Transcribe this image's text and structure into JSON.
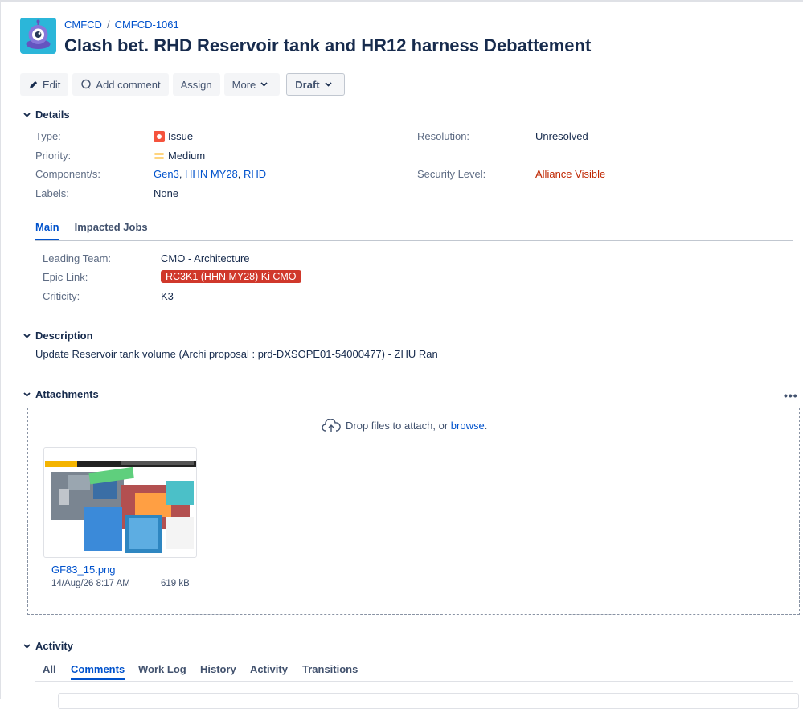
{
  "breadcrumb": {
    "project": "CMFCD",
    "separator": "/",
    "issue_key": "CMFCD-1061"
  },
  "title": "Clash bet. RHD Reservoir tank and HR12 harness Debattement",
  "toolbar": {
    "edit_label": "Edit",
    "comment_label": "Add comment",
    "assign_label": "Assign",
    "more_label": "More",
    "status_label": "Draft"
  },
  "details": {
    "heading": "Details",
    "type_label": "Type:",
    "type_value": "Issue",
    "priority_label": "Priority:",
    "priority_value": "Medium",
    "components_label": "Component/s:",
    "components": [
      "Gen3",
      "HHN MY28",
      "RHD"
    ],
    "component_separator": ", ",
    "labels_label": "Labels:",
    "labels_value": "None",
    "resolution_label": "Resolution:",
    "resolution_value": "Unresolved",
    "security_label": "Security Level:",
    "security_value": "Alliance Visible"
  },
  "tabs": [
    "Main",
    "Impacted Jobs"
  ],
  "main": {
    "leading_team_label": "Leading Team:",
    "leading_team_value": "CMO - Architecture",
    "epic_link_label": "Epic Link:",
    "epic_link_value": "RC3K1 (HHN MY28) Ki CMO",
    "criticity_label": "Criticity:",
    "criticity_value": "K3"
  },
  "description": {
    "heading": "Description",
    "text": "Update Reservoir tank volume (Archi proposal : prd-DXSOPE01-54000477) - ZHU Ran"
  },
  "attachments": {
    "heading": "Attachments",
    "more_icon": "•••",
    "drop_text": "Drop files to attach, or ",
    "browse_text": "browse",
    "drop_suffix": ".",
    "file": {
      "name": "GF83_15.png",
      "date": "14/Aug/26 8:17 AM",
      "size": "619 kB"
    }
  },
  "activity": {
    "heading": "Activity",
    "tabs": [
      "All",
      "Comments",
      "Work Log",
      "History",
      "Activity",
      "Transitions"
    ],
    "active_tab": "Comments"
  },
  "colors": {
    "link": "#0052cc",
    "issue_type": "#f5533d",
    "priority_medium": "#ffab00",
    "epic_lozenge": "#d0382b",
    "security": "#bf2600"
  },
  "icons": [
    "project-avatar-icon",
    "pencil-icon",
    "comment-icon",
    "chevron-down-icon",
    "issue-type-icon",
    "priority-medium-icon",
    "cloud-upload-icon",
    "more-icon"
  ]
}
